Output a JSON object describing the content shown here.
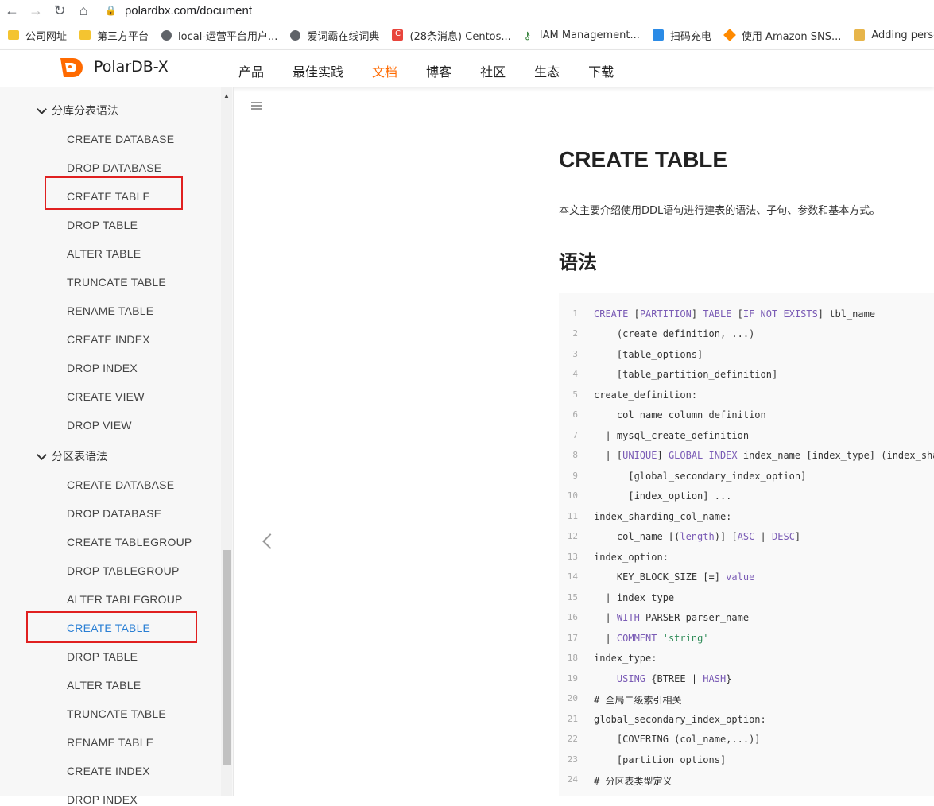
{
  "browser": {
    "url": "polardbx.com/document",
    "bookmarks": [
      {
        "icon": "folder-icon",
        "label": "公司网址"
      },
      {
        "icon": "folder-icon",
        "label": "第三方平台"
      },
      {
        "icon": "globe-icon",
        "label": "local-运营平台用户..."
      },
      {
        "icon": "globe-icon",
        "label": "爱词霸在线词典"
      },
      {
        "icon": "csdn-icon",
        "label": "(28条消息) Centos..."
      },
      {
        "icon": "key-icon",
        "label": "IAM Management..."
      },
      {
        "icon": "charge-icon",
        "label": "扫码充电"
      },
      {
        "icon": "aws-icon",
        "label": "使用 Amazon SNS..."
      },
      {
        "icon": "box-icon",
        "label": "Adding personali..."
      }
    ]
  },
  "header": {
    "brand": "PolarDB-X",
    "nav": [
      "产品",
      "最佳实践",
      "文档",
      "博客",
      "社区",
      "生态",
      "下载"
    ],
    "active_nav": "文档",
    "accent_color": "#ff6a00"
  },
  "sidebar": {
    "sections": [
      {
        "title": "分库分表语法",
        "items": [
          "CREATE DATABASE",
          "DROP DATABASE",
          "CREATE TABLE",
          "DROP TABLE",
          "ALTER TABLE",
          "TRUNCATE TABLE",
          "RENAME TABLE",
          "CREATE INDEX",
          "DROP INDEX",
          "CREATE VIEW",
          "DROP VIEW"
        ]
      },
      {
        "title": "分区表语法",
        "items": [
          "CREATE DATABASE",
          "DROP DATABASE",
          "CREATE TABLEGROUP",
          "DROP TABLEGROUP",
          "ALTER TABLEGROUP",
          "CREATE TABLE",
          "DROP TABLE",
          "ALTER TABLE",
          "TRUNCATE TABLE",
          "RENAME TABLE",
          "CREATE INDEX",
          "DROP INDEX"
        ]
      }
    ],
    "selected_color": "#2a7fd4"
  },
  "content": {
    "title": "CREATE TABLE",
    "intro": "本文主要介绍使用DDL语句进行建表的语法、子句、参数和基本方式。",
    "syntax_heading": "语法",
    "code_lines": [
      "1",
      "2",
      "3",
      "4",
      "5",
      "6",
      "7",
      "8",
      "9",
      "10",
      "11",
      "12",
      "13",
      "14",
      "15",
      "16",
      "17",
      "18",
      "19",
      "20",
      "21",
      "22",
      "23",
      "24"
    ],
    "code_text": {
      "l1a": "CREATE",
      "l1b": " [",
      "l1c": "PARTITION",
      "l1d": "] ",
      "l1e": "TABLE",
      "l1f": " [",
      "l1g": "IF NOT EXISTS",
      "l1h": "] tbl_name",
      "l2": "    (create_definition, ...)",
      "l3": "    [table_options]",
      "l4": "    [table_partition_definition]",
      "l5": "create_definition:",
      "l6": "    col_name column_definition",
      "l7": "  | mysql_create_definition",
      "l8a": "  | [",
      "l8b": "UNIQUE",
      "l8c": "] ",
      "l8d": "GLOBAL INDEX",
      "l8e": " index_name [index_type] (index_sharding_col_name,...)",
      "l9": "      [global_secondary_index_option]",
      "l10": "      [index_option] ...",
      "l11": "index_sharding_col_name:",
      "l12a": "    col_name [(",
      "l12b": "length",
      "l12c": ")] [",
      "l12d": "ASC",
      "l12e": " | ",
      "l12f": "DESC",
      "l12g": "]",
      "l13": "index_option:",
      "l14a": "    KEY_BLOCK_SIZE [=] ",
      "l14b": "value",
      "l15": "  | index_type",
      "l16a": "  | ",
      "l16b": "WITH",
      "l16c": " PARSER parser_name",
      "l17a": "  | ",
      "l17b": "COMMENT",
      "l17c": " ",
      "l17d": "'string'",
      "l18": "index_type:",
      "l19a": "    ",
      "l19b": "USING",
      "l19c": " {BTREE | ",
      "l19d": "HASH",
      "l19e": "}",
      "l20": "# 全局二级索引相关",
      "l21": "global_secondary_index_option:",
      "l22": "    [COVERING (col_name,...)]",
      "l23": "    [partition_options]",
      "l24": "# 分区表类型定义"
    }
  }
}
